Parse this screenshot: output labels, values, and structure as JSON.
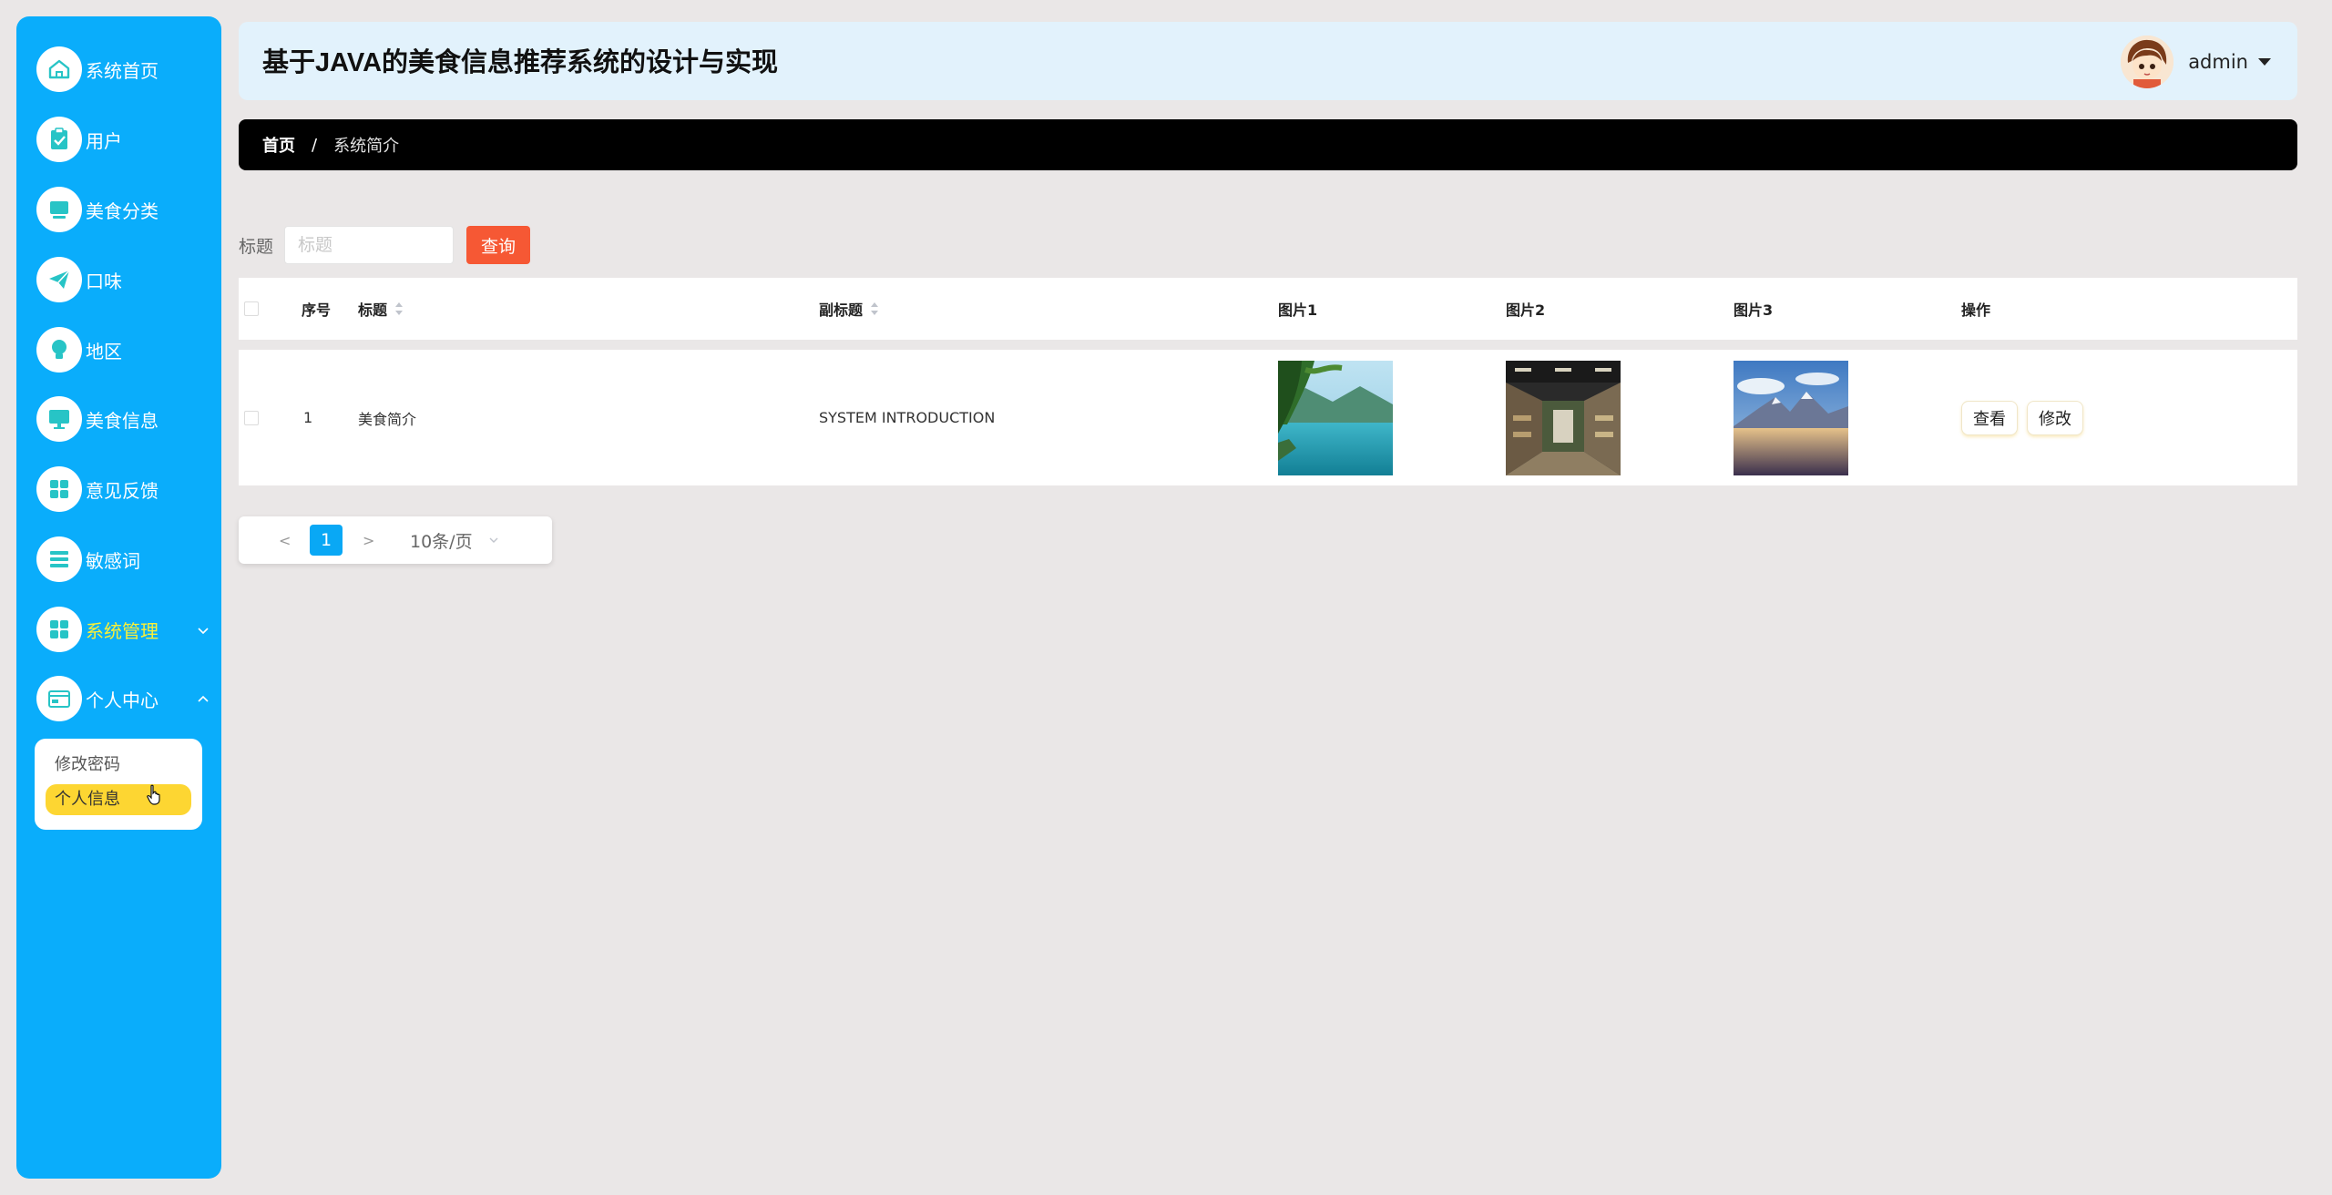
{
  "app": {
    "title": "基于JAVA的美食信息推荐系统的设计与实现",
    "user": "admin"
  },
  "sidebar": {
    "items": [
      {
        "label": "系统首页",
        "icon": "home-icon"
      },
      {
        "label": "用户",
        "icon": "clipboard-icon"
      },
      {
        "label": "美食分类",
        "icon": "monitor-icon"
      },
      {
        "label": "口味",
        "icon": "paper-plane-icon"
      },
      {
        "label": "地区",
        "icon": "lightbulb-icon"
      },
      {
        "label": "美食信息",
        "icon": "desktop-icon"
      },
      {
        "label": "意见反馈",
        "icon": "grid-icon"
      },
      {
        "label": "敏感词",
        "icon": "list-icon"
      },
      {
        "label": "系统管理",
        "icon": "grid-icon"
      },
      {
        "label": "个人中心",
        "icon": "card-icon"
      }
    ],
    "submenu": {
      "items": [
        "修改密码",
        "个人信息"
      ],
      "active_index": 1
    },
    "colors": {
      "background": "#0aadfb",
      "highlight": "#fbf037",
      "active_sub": "#fdd632"
    }
  },
  "breadcrumb": {
    "home": "首页",
    "separator": "/",
    "current": "系统简介"
  },
  "search": {
    "label": "标题",
    "placeholder": "标题",
    "value": "",
    "button": "查询"
  },
  "table": {
    "headers": {
      "index": "序号",
      "title": "标题",
      "subtitle": "副标题",
      "image1": "图片1",
      "image2": "图片2",
      "image3": "图片3",
      "actions": "操作"
    },
    "rows": [
      {
        "index": "1",
        "title": "美食简介",
        "subtitle": "SYSTEM INTRODUCTION",
        "image1": "lake-landscape",
        "image2": "restaurant-interior",
        "image3": "mountain-landscape",
        "view": "查看",
        "edit": "修改"
      }
    ]
  },
  "pagination": {
    "prev": "<",
    "current_page": "1",
    "next": ">",
    "page_size": "10条/页"
  }
}
